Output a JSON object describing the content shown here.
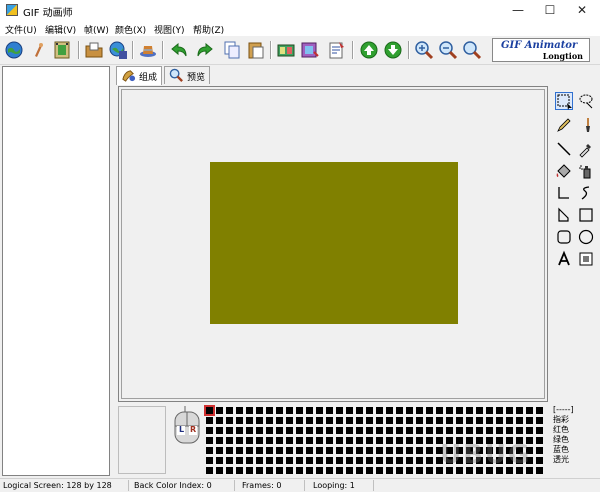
{
  "window": {
    "title": "GIF 动画师",
    "icon": "app-icon",
    "controls": [
      "—",
      "☐",
      "✕"
    ]
  },
  "menu": [
    "文件(U)",
    "编辑(V)",
    "帧(W)",
    "颜色(X)",
    "视图(Y)",
    "帮助(Z)"
  ],
  "toolbar": {
    "buttons": [
      "globe-icon",
      "wrench-icon",
      "film-icon",
      "open-folder-icon",
      "save-globe-icon",
      "hat-icon",
      "undo-icon",
      "redo-icon",
      "copy-icon",
      "paste-icon",
      "frames-icon",
      "frame-edit-icon",
      "properties-icon",
      "move-up-icon",
      "move-down-icon",
      "zoom-in-icon",
      "zoom-out-icon",
      "zoom-reset-icon"
    ]
  },
  "brand": {
    "title": "GIF Animator",
    "subtitle": "Longtion"
  },
  "tabs": [
    {
      "label": "组成",
      "icon": "paint-icon",
      "active": true
    },
    {
      "label": "预览",
      "icon": "magnifier-icon",
      "active": false
    }
  ],
  "canvas": {
    "frame_color": "#808000"
  },
  "tools": [
    "select-rect-icon",
    "lasso-icon",
    "pencil-icon",
    "brush-icon",
    "line-icon",
    "eyedropper-icon",
    "fill-icon",
    "spray-icon",
    "polyline-icon",
    "curve-icon",
    "polygon-icon",
    "rectangle-icon",
    "rounded-rect-icon",
    "ellipse-icon",
    "text-icon",
    "eraser-icon"
  ],
  "color_info": {
    "lines": [
      "[-----]",
      "指彩",
      "红色",
      "绿色",
      "蓝色",
      "透光"
    ]
  },
  "mouse_labels": {
    "left": "L",
    "right": "R"
  },
  "status": {
    "logical_screen": "Logical Screen: 128 by 128",
    "back_color": "Back Color Index: 0",
    "frames": "Frames: 0",
    "looping": "Looping: 1"
  },
  "watermark": "UBUG"
}
